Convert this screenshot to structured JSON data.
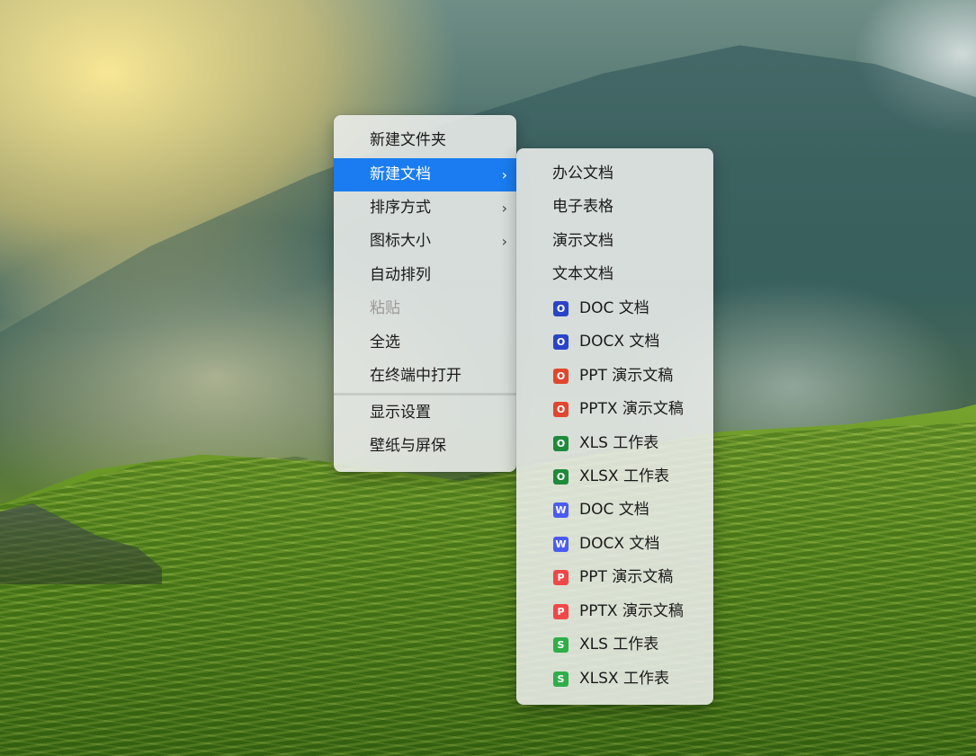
{
  "main_menu": {
    "items": [
      {
        "label": "新建文件夹"
      },
      {
        "label": "新建文档",
        "submenu": true,
        "selected": true
      },
      {
        "label": "排序方式",
        "submenu": true
      },
      {
        "label": "图标大小",
        "submenu": true
      },
      {
        "label": "自动排列"
      },
      {
        "label": "粘贴",
        "disabled": true
      },
      {
        "label": "全选"
      },
      {
        "label": "在终端中打开"
      },
      {
        "label": "显示设置"
      },
      {
        "label": "壁纸与屏保"
      }
    ]
  },
  "submenu_chevron": "›",
  "new_document_submenu": {
    "items": [
      {
        "label": "办公文档"
      },
      {
        "label": "电子表格"
      },
      {
        "label": "演示文档"
      },
      {
        "label": "文本文档"
      },
      {
        "label": "DOC 文档",
        "icon": "doc-icon",
        "icon_letter": "O",
        "icon_color": "#2a44c8"
      },
      {
        "label": "DOCX 文档",
        "icon": "docx-icon",
        "icon_letter": "O",
        "icon_color": "#2a44c8"
      },
      {
        "label": "PPT 演示文稿",
        "icon": "ppt-icon",
        "icon_letter": "O",
        "icon_color": "#e0472f"
      },
      {
        "label": "PPTX 演示文稿",
        "icon": "pptx-icon",
        "icon_letter": "O",
        "icon_color": "#e0472f"
      },
      {
        "label": "XLS 工作表",
        "icon": "xls-icon",
        "icon_letter": "O",
        "icon_color": "#1f8a3a"
      },
      {
        "label": "XLSX 工作表",
        "icon": "xlsx-icon",
        "icon_letter": "O",
        "icon_color": "#1f8a3a"
      },
      {
        "label": "DOC 文档",
        "icon": "wps-doc-icon",
        "icon_letter": "W",
        "icon_color": "#4b5cf0"
      },
      {
        "label": "DOCX 文档",
        "icon": "wps-docx-icon",
        "icon_letter": "W",
        "icon_color": "#4b5cf0"
      },
      {
        "label": "PPT 演示文稿",
        "icon": "wps-ppt-icon",
        "icon_letter": "P",
        "icon_color": "#f04848"
      },
      {
        "label": "PPTX 演示文稿",
        "icon": "wps-pptx-icon",
        "icon_letter": "P",
        "icon_color": "#f04848"
      },
      {
        "label": "XLS 工作表",
        "icon": "wps-xls-icon",
        "icon_letter": "S",
        "icon_color": "#2fae4a"
      },
      {
        "label": "XLSX 工作表",
        "icon": "wps-xlsx-icon",
        "icon_letter": "S",
        "icon_color": "#2fae4a"
      }
    ]
  }
}
